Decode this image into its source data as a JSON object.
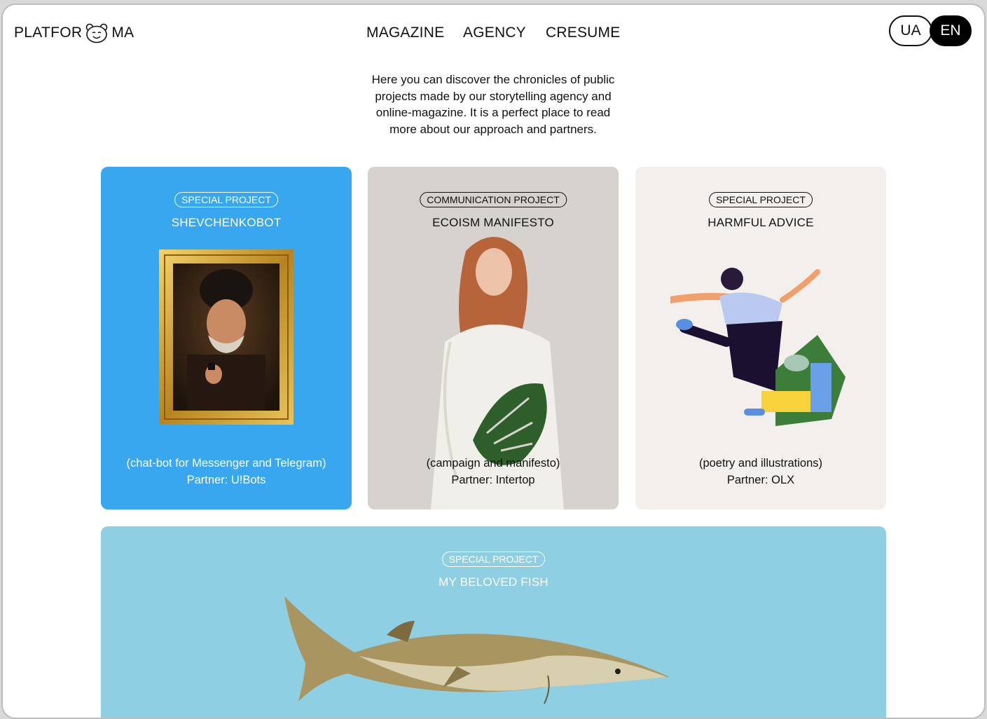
{
  "header": {
    "logo_left": "PLATFOR",
    "logo_right": "MA",
    "logo_icon": "bear-face-icon",
    "nav": [
      "MAGAZINE",
      "AGENCY",
      "CRESUME"
    ],
    "languages": [
      "UA",
      "EN"
    ],
    "active_language": "EN"
  },
  "intro": {
    "lines": [
      "Here you can discover the chronicles of public",
      "projects made by our storytelling agency and",
      "online-magazine. It is a perfect place to read",
      "more about our approach and partners."
    ]
  },
  "projects": [
    {
      "tag": "SPECIAL PROJECT",
      "title": "SHEVCHENKOBOT",
      "desc": "(chat-bot for Messenger and Telegram)",
      "partner": "Partner: U!Bots",
      "background": "#39a7f0",
      "image": "framed-portrait-painting"
    },
    {
      "tag": "COMMUNICATION PROJECT",
      "title": "ECOISM MANIFESTO",
      "desc": "(campaign and manifesto)",
      "partner": "Partner: Intertop",
      "background": "#d8d4cf",
      "image": "woman-with-monstera-leaf-photo"
    },
    {
      "tag": "SPECIAL PROJECT",
      "title": "HARMFUL ADVICE",
      "desc": "(poetry and illustrations)",
      "partner": "Partner: OLX",
      "background": "#f2efec",
      "image": "illustration-woman-over-trash-pile"
    },
    {
      "tag": "SPECIAL PROJECT",
      "title": "MY BELOVED FISH",
      "background": "#8ecfe4",
      "image": "sturgeon-fish-photo"
    }
  ]
}
